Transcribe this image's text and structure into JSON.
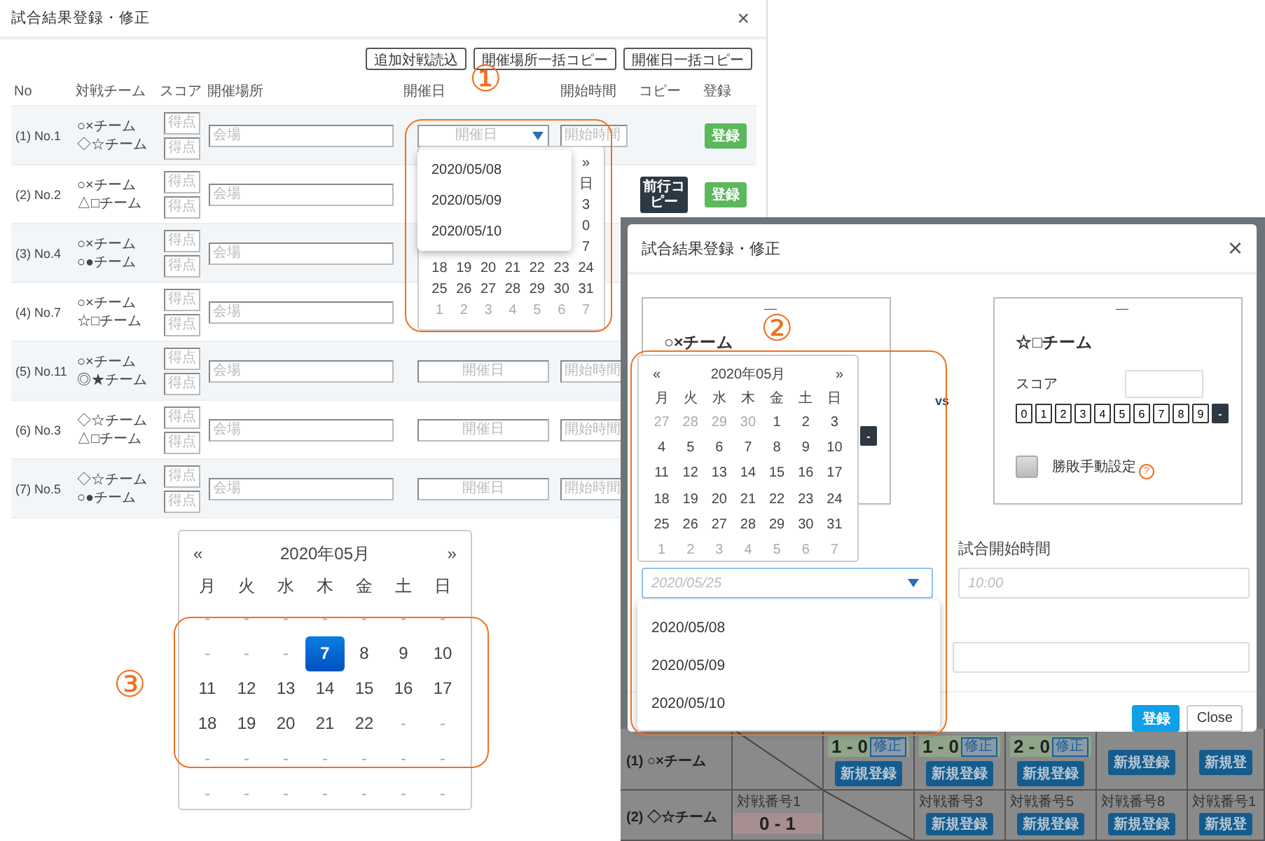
{
  "main_dialog": {
    "title": "試合結果登録・修正",
    "close": "×",
    "toolbar": [
      "追加対戦読込",
      "開催場所一括コピー",
      "開催日一括コピー"
    ],
    "columns": [
      "No",
      "対戦チーム",
      "スコア",
      "開催場所",
      "開催日",
      "開始時間",
      "コピー",
      "登録"
    ],
    "rows": [
      {
        "no": "(1) No.1",
        "teams": [
          "○×チーム",
          "◇☆チーム"
        ],
        "score_placeholders": [
          "得点",
          "得点"
        ],
        "venue_placeholder": "会場",
        "date_placeholder": "開催日",
        "date_open": true,
        "time_placeholder": "開始時間",
        "register": "登録"
      },
      {
        "no": "(2) No.2",
        "teams": [
          "○×チーム",
          "△□チーム"
        ],
        "score_placeholders": [
          "得点",
          "得点"
        ],
        "venue_placeholder": "会場",
        "copy": "前行コピー",
        "register": "登録"
      },
      {
        "no": "(3) No.4",
        "teams": [
          "○×チーム",
          "○●チーム"
        ],
        "score_placeholders": [
          "得点",
          "得点"
        ],
        "venue_placeholder": "会場"
      },
      {
        "no": "(4) No.7",
        "teams": [
          "○×チーム",
          "☆□チーム"
        ],
        "score_placeholders": [
          "得点",
          "得点"
        ],
        "venue_placeholder": "会場"
      },
      {
        "no": "(5) No.11",
        "teams": [
          "○×チーム",
          "◎★チーム"
        ],
        "score_placeholders": [
          "得点",
          "得点"
        ],
        "venue_placeholder": "会場",
        "date_placeholder": "開催日",
        "date_open": false,
        "time_placeholder": "開始時間"
      },
      {
        "no": "(6) No.3",
        "teams": [
          "◇☆チーム",
          "△□チーム"
        ],
        "score_placeholders": [
          "得点",
          "得点"
        ],
        "venue_placeholder": "会場",
        "date_placeholder": "開催日",
        "date_open": false,
        "time_placeholder": "開始時間"
      },
      {
        "no": "(7) No.5",
        "teams": [
          "◇☆チーム",
          "○●チーム"
        ],
        "score_placeholders": [
          "得点",
          "得点"
        ],
        "venue_placeholder": "会場",
        "date_placeholder": "開催日",
        "date_open": false,
        "time_placeholder": "開始時間"
      }
    ],
    "date_popup": {
      "calendar": {
        "edge_column": [
          "»",
          "日",
          "3",
          "0",
          "7"
        ],
        "weeks": [
          [
            {
              "text": "18",
              "muted": false,
              "selected": false
            },
            {
              "text": "19",
              "muted": false,
              "selected": false
            },
            {
              "text": "20",
              "muted": false,
              "selected": false
            },
            {
              "text": "21",
              "muted": false,
              "selected": false
            },
            {
              "text": "22",
              "muted": false,
              "selected": false
            },
            {
              "text": "23",
              "muted": false,
              "selected": false
            },
            {
              "text": "24",
              "muted": false,
              "selected": false
            }
          ],
          [
            {
              "text": "25",
              "muted": false,
              "selected": false
            },
            {
              "text": "26",
              "muted": false,
              "selected": false
            },
            {
              "text": "27",
              "muted": false,
              "selected": false
            },
            {
              "text": "28",
              "muted": false,
              "selected": false
            },
            {
              "text": "29",
              "muted": false,
              "selected": false
            },
            {
              "text": "30",
              "muted": false,
              "selected": false
            },
            {
              "text": "31",
              "muted": false,
              "selected": false
            }
          ],
          [
            {
              "text": "1",
              "muted": true,
              "selected": false
            },
            {
              "text": "2",
              "muted": true,
              "selected": false
            },
            {
              "text": "3",
              "muted": true,
              "selected": false
            },
            {
              "text": "4",
              "muted": true,
              "selected": false
            },
            {
              "text": "5",
              "muted": true,
              "selected": false
            },
            {
              "text": "6",
              "muted": true,
              "selected": false
            },
            {
              "text": "7",
              "muted": true,
              "selected": false
            }
          ]
        ]
      },
      "options": [
        {
          "text": "2020/05/08",
          "selected": false
        },
        {
          "text": "2020/05/09",
          "selected": false
        },
        {
          "text": "2020/05/10",
          "selected": false
        }
      ]
    },
    "calendar_popup": {
      "prev": "«",
      "title": "2020年05月",
      "next": "»",
      "weekdays": [
        "月",
        "火",
        "水",
        "木",
        "金",
        "土",
        "日"
      ],
      "weeks": [
        [
          {
            "text": "-",
            "muted": true,
            "selected": false
          },
          {
            "text": "-",
            "muted": true,
            "selected": false
          },
          {
            "text": "-",
            "muted": true,
            "selected": false
          },
          {
            "text": "-",
            "muted": true,
            "selected": false
          },
          {
            "text": "-",
            "muted": true,
            "selected": false
          },
          {
            "text": "-",
            "muted": true,
            "selected": false
          },
          {
            "text": "-",
            "muted": true,
            "selected": false
          }
        ],
        [
          {
            "text": "-",
            "muted": true,
            "selected": false
          },
          {
            "text": "-",
            "muted": true,
            "selected": false
          },
          {
            "text": "-",
            "muted": true,
            "selected": false
          },
          {
            "text": "7",
            "muted": false,
            "selected": true
          },
          {
            "text": "8",
            "muted": false,
            "selected": false
          },
          {
            "text": "9",
            "muted": false,
            "selected": false
          },
          {
            "text": "10",
            "muted": false,
            "selected": false
          }
        ],
        [
          {
            "text": "11",
            "muted": false,
            "selected": false
          },
          {
            "text": "12",
            "muted": false,
            "selected": false
          },
          {
            "text": "13",
            "muted": false,
            "selected": false
          },
          {
            "text": "14",
            "muted": false,
            "selected": false
          },
          {
            "text": "15",
            "muted": false,
            "selected": false
          },
          {
            "text": "16",
            "muted": false,
            "selected": false
          },
          {
            "text": "17",
            "muted": false,
            "selected": false
          }
        ],
        [
          {
            "text": "18",
            "muted": false,
            "selected": false
          },
          {
            "text": "19",
            "muted": false,
            "selected": false
          },
          {
            "text": "20",
            "muted": false,
            "selected": false
          },
          {
            "text": "21",
            "muted": false,
            "selected": false
          },
          {
            "text": "22",
            "muted": false,
            "selected": false
          },
          {
            "text": "-",
            "muted": true,
            "selected": false
          },
          {
            "text": "-",
            "muted": true,
            "selected": false
          }
        ],
        [
          {
            "text": "-",
            "muted": true,
            "selected": false
          },
          {
            "text": "-",
            "muted": true,
            "selected": false
          },
          {
            "text": "-",
            "muted": true,
            "selected": false
          },
          {
            "text": "-",
            "muted": true,
            "selected": false
          },
          {
            "text": "-",
            "muted": true,
            "selected": false
          },
          {
            "text": "-",
            "muted": true,
            "selected": false
          },
          {
            "text": "-",
            "muted": true,
            "selected": false
          }
        ],
        [
          {
            "text": "-",
            "muted": true,
            "selected": false
          },
          {
            "text": "-",
            "muted": true,
            "selected": false
          },
          {
            "text": "-",
            "muted": true,
            "selected": false
          },
          {
            "text": "-",
            "muted": true,
            "selected": false
          },
          {
            "text": "-",
            "muted": true,
            "selected": false
          },
          {
            "text": "-",
            "muted": true,
            "selected": false
          },
          {
            "text": "-",
            "muted": true,
            "selected": false
          }
        ]
      ]
    }
  },
  "result_grid": {
    "rows": [
      {
        "label": "(1) ○×チーム",
        "cells": [
          {
            "kind": "self"
          },
          {
            "kind": "win",
            "score": "1 - 0",
            "edit": "修正",
            "new": "新規登録"
          },
          {
            "kind": "win",
            "score": "1 - 0",
            "edit": "修正",
            "new": "新規登録"
          },
          {
            "kind": "win",
            "score": "2 - 0",
            "edit": "修正",
            "new": "新規登録"
          },
          {
            "kind": "open",
            "new": "新規登録"
          },
          {
            "kind": "open",
            "new": "新規登"
          }
        ]
      },
      {
        "label": "(2) ◇☆チーム",
        "cells": [
          {
            "kind": "loss",
            "match_no": "対戦番号1",
            "score": "0 - 1"
          },
          {
            "kind": "self"
          },
          {
            "kind": "open",
            "match_no": "対戦番号3",
            "new": "新規登録"
          },
          {
            "kind": "open",
            "match_no": "対戦番号5",
            "new": "新規登録"
          },
          {
            "kind": "open",
            "match_no": "対戦番号8",
            "new": "新規登録"
          },
          {
            "kind": "open",
            "match_no": "対戦番号1",
            "new": "新規登"
          }
        ]
      }
    ]
  },
  "match_dialog": {
    "title": "試合結果登録・修正",
    "close": "×",
    "home": {
      "mark": "—",
      "team": "○×チーム",
      "clear": "-"
    },
    "versus": "vs",
    "away": {
      "mark": "—",
      "team": "☆□チーム",
      "score_label": "スコア",
      "digits": [
        "0",
        "1",
        "2",
        "3",
        "4",
        "5",
        "6",
        "7",
        "8",
        "9"
      ],
      "clear": "-",
      "manual": {
        "label": "勝敗手動設定",
        "checked": false
      },
      "help": "?"
    },
    "time_label": "試合開始時間",
    "date_field": {
      "placeholder": "2020/05/25"
    },
    "time_field": {
      "placeholder": "10:00"
    },
    "buttons": [
      {
        "label": "登録",
        "kind": "primary"
      },
      {
        "label": "Close",
        "kind": "default"
      }
    ],
    "calendar": {
      "prev": "«",
      "title": "2020年05月",
      "next": "»",
      "weekdays": [
        "月",
        "火",
        "水",
        "木",
        "金",
        "土",
        "日"
      ],
      "weeks": [
        [
          {
            "text": "27",
            "muted": true,
            "selected": false
          },
          {
            "text": "28",
            "muted": true,
            "selected": false
          },
          {
            "text": "29",
            "muted": true,
            "selected": false
          },
          {
            "text": "30",
            "muted": true,
            "selected": false
          },
          {
            "text": "1",
            "muted": false,
            "selected": false
          },
          {
            "text": "2",
            "muted": false,
            "selected": false
          },
          {
            "text": "3",
            "muted": false,
            "selected": false
          }
        ],
        [
          {
            "text": "4",
            "muted": false,
            "selected": false
          },
          {
            "text": "5",
            "muted": false,
            "selected": false
          },
          {
            "text": "6",
            "muted": false,
            "selected": false
          },
          {
            "text": "7",
            "muted": false,
            "selected": false
          },
          {
            "text": "8",
            "muted": false,
            "selected": false
          },
          {
            "text": "9",
            "muted": false,
            "selected": false
          },
          {
            "text": "10",
            "muted": false,
            "selected": false
          }
        ],
        [
          {
            "text": "11",
            "muted": false,
            "selected": false
          },
          {
            "text": "12",
            "muted": false,
            "selected": false
          },
          {
            "text": "13",
            "muted": false,
            "selected": false
          },
          {
            "text": "14",
            "muted": false,
            "selected": false
          },
          {
            "text": "15",
            "muted": false,
            "selected": false
          },
          {
            "text": "16",
            "muted": false,
            "selected": false
          },
          {
            "text": "17",
            "muted": false,
            "selected": false
          }
        ],
        [
          {
            "text": "18",
            "muted": false,
            "selected": false
          },
          {
            "text": "19",
            "muted": false,
            "selected": false
          },
          {
            "text": "20",
            "muted": false,
            "selected": false
          },
          {
            "text": "21",
            "muted": false,
            "selected": false
          },
          {
            "text": "22",
            "muted": false,
            "selected": false
          },
          {
            "text": "23",
            "muted": false,
            "selected": false
          },
          {
            "text": "24",
            "muted": false,
            "selected": false
          }
        ],
        [
          {
            "text": "25",
            "muted": false,
            "selected": false
          },
          {
            "text": "26",
            "muted": false,
            "selected": false
          },
          {
            "text": "27",
            "muted": false,
            "selected": false
          },
          {
            "text": "28",
            "muted": false,
            "selected": false
          },
          {
            "text": "29",
            "muted": false,
            "selected": false
          },
          {
            "text": "30",
            "muted": false,
            "selected": false
          },
          {
            "text": "31",
            "muted": false,
            "selected": false
          }
        ],
        [
          {
            "text": "1",
            "muted": true,
            "selected": false
          },
          {
            "text": "2",
            "muted": true,
            "selected": false
          },
          {
            "text": "3",
            "muted": true,
            "selected": false
          },
          {
            "text": "4",
            "muted": true,
            "selected": false
          },
          {
            "text": "5",
            "muted": true,
            "selected": false
          },
          {
            "text": "6",
            "muted": true,
            "selected": false
          },
          {
            "text": "7",
            "muted": true,
            "selected": false
          }
        ]
      ]
    },
    "options": [
      {
        "text": "2020/05/08",
        "selected": false
      },
      {
        "text": "2020/05/09",
        "selected": false
      },
      {
        "text": "2020/05/10",
        "selected": false
      }
    ]
  },
  "annotations": [
    {
      "number": "①"
    },
    {
      "number": "②"
    },
    {
      "number": "③"
    }
  ]
}
